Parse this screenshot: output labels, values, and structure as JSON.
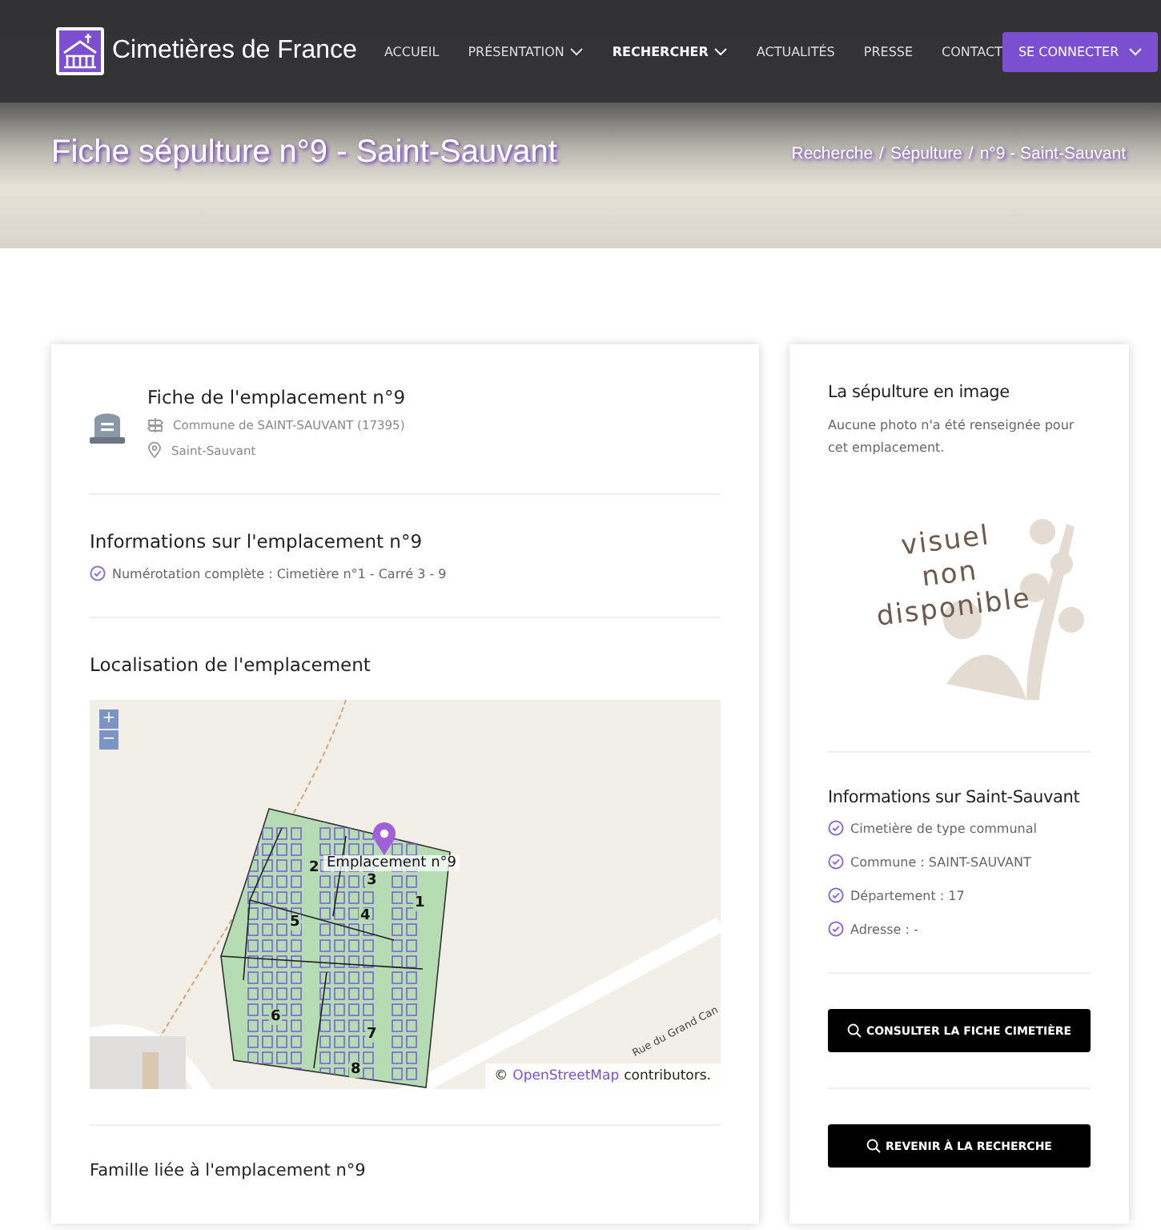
{
  "header": {
    "brand": "Cimetières de France",
    "nav": [
      {
        "label": "ACCUEIL",
        "selected": false,
        "dropdown": false
      },
      {
        "label": "PRÉSENTATION",
        "selected": false,
        "dropdown": true
      },
      {
        "label": "RECHERCHER",
        "selected": true,
        "dropdown": true
      },
      {
        "label": "ACTUALITÉS",
        "selected": false,
        "dropdown": false
      },
      {
        "label": "PRESSE",
        "selected": false,
        "dropdown": false
      },
      {
        "label": "CONTACT",
        "selected": false,
        "dropdown": false
      }
    ],
    "login_button": "SE CONNECTER"
  },
  "hero": {
    "title": "Fiche sépulture n°9 - Saint-Sauvant",
    "breadcrumb": [
      "Recherche",
      "Sépulture",
      "n°9 - Saint-Sauvant"
    ],
    "breadcrumb_separator": "/"
  },
  "main": {
    "title": "Fiche de l'emplacement n°9",
    "commune": "Commune de SAINT-SAUVANT (17395)",
    "place": "Saint-Sauvant",
    "info_title": "Informations sur l'emplacement n°9",
    "info_items": [
      "Numérotation complète : Cimetière n°1 - Carré 3 - 9"
    ],
    "map_title": "Localisation de l'emplacement",
    "map": {
      "zoom_in": "+",
      "zoom_out": "−",
      "marker_label": "Emplacement n°9",
      "sections": [
        "1",
        "2",
        "3",
        "4",
        "5",
        "6",
        "7",
        "8"
      ],
      "street": "Rue du Grand Can",
      "attribution_prefix": "©",
      "attribution_link": "OpenStreetMap",
      "attribution_suffix": "contributors."
    },
    "family_title": "Famille liée à l'emplacement n°9"
  },
  "side": {
    "image_title": "La sépulture en image",
    "image_note": "Aucune photo n'a été renseignée pour cet emplacement.",
    "placeholder_text": [
      "visuel",
      "non",
      "disponible"
    ],
    "info_title": "Informations sur Saint-Sauvant",
    "info_items": [
      "Cimetière de type communal",
      "Commune : SAINT-SAUVANT",
      "Département : 17",
      "Adresse : -"
    ],
    "buttons": [
      "CONSULTER LA FICHE CIMETIÈRE",
      "REVENIR À LA RECHERCHE"
    ]
  }
}
